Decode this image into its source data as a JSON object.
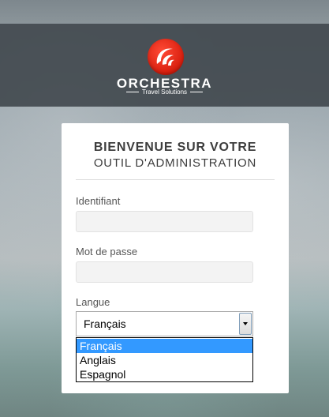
{
  "brand": {
    "name": "ORCHESTRA",
    "tagline": "Travel Solutions"
  },
  "login": {
    "title_line1": "BIENVENUE SUR VOTRE",
    "title_line2": "OUTIL D'ADMINISTRATION",
    "identifiant_label": "Identifiant",
    "identifiant_value": "",
    "password_label": "Mot de passe",
    "password_value": "",
    "langue_label": "Langue",
    "langue_selected": "Français",
    "langue_options": [
      "Français",
      "Anglais",
      "Espagnol"
    ]
  },
  "colors": {
    "logo_red": "#d81e0e",
    "header_bg": "#3e444a",
    "highlight": "#3399ff"
  },
  "icons": {
    "logo": "orchestra-swirl-logo",
    "dropdown_arrow": "chevron-down-icon"
  }
}
